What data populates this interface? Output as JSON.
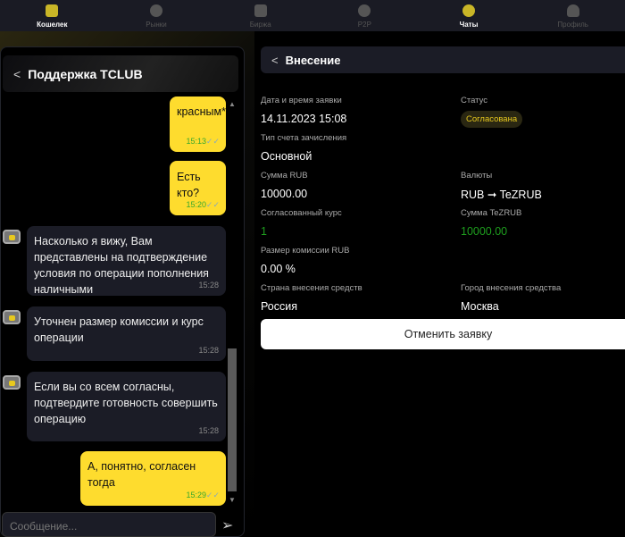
{
  "nav": [
    {
      "label": "Кошелек",
      "active": true
    },
    {
      "label": "Рынки"
    },
    {
      "label": "Биржа"
    },
    {
      "label": "P2P"
    },
    {
      "label": "Чаты",
      "active": true
    },
    {
      "label": "Профиль"
    }
  ],
  "chat": {
    "title": "Поддержка TCLUB",
    "input_placeholder": "Сообщение...",
    "messages": [
      {
        "text": "красным*",
        "time": "15:13",
        "dir": "out"
      },
      {
        "text": "Есть кто?",
        "time": "15:20",
        "dir": "out"
      },
      {
        "text": "Насколько я вижу, Вам представлены на подтверждение условия по операции пополнения наличными",
        "time": "15:28",
        "dir": "in"
      },
      {
        "text": "Уточнен размер комиссии и курс операции",
        "time": "15:28",
        "dir": "in"
      },
      {
        "text": "Если вы со всем согласны, подтвердите готовность совершить операцию",
        "time": "15:28",
        "dir": "in"
      },
      {
        "text": "А, понятно, согласен тогда",
        "time": "15:29",
        "dir": "out"
      }
    ],
    "read_ticks": "✓✓"
  },
  "details": {
    "title": "Внесение",
    "date_label": "Дата и время заявки",
    "date": "14.11.2023 15:08",
    "status_label": "Статус",
    "status": "Согласована",
    "account_label": "Тип счета зачисления",
    "account": "Основной",
    "sum_rub_label": "Сумма RUB",
    "sum_rub": "10000.00",
    "currencies_label": "Валюты",
    "currencies": "RUB ➞ TeZRUB",
    "rate_label": "Согласованный курс",
    "rate": "1",
    "sum_tez_label": "Сумма TeZRUB",
    "sum_tez": "10000.00",
    "fee_label": "Размер комиссии RUB",
    "fee": "0.00 %",
    "country_label": "Страна внесения средств",
    "country": "Россия",
    "city_label": "Город внесения средства",
    "city": "Москва",
    "cancel_label": "Отменить заявку"
  },
  "colors": {
    "accent": "#fedc2e",
    "green": "#1e9e1e"
  }
}
